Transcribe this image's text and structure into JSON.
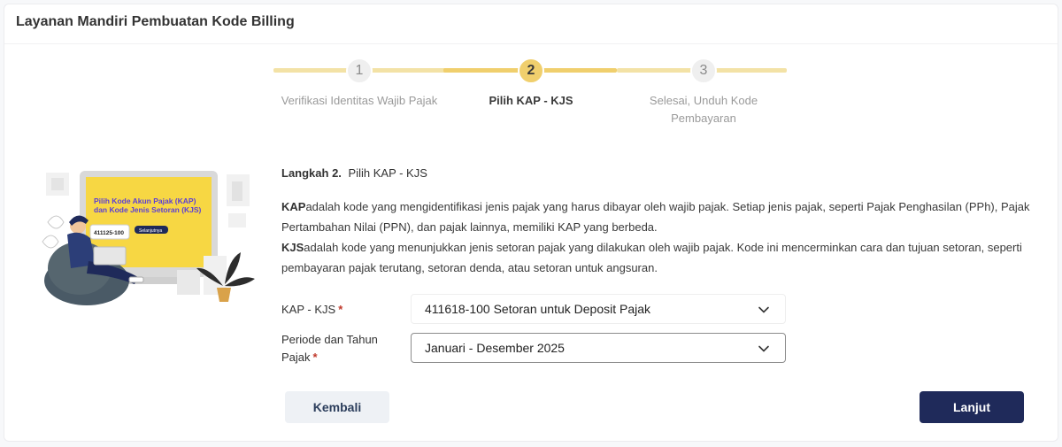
{
  "header": {
    "title": "Layanan Mandiri Pembuatan Kode Billing"
  },
  "stepper": {
    "steps": [
      {
        "number": "1",
        "label": "Verifikasi Identitas Wajib Pajak"
      },
      {
        "number": "2",
        "label": "Pilih KAP - KJS"
      },
      {
        "number": "3",
        "label": "Selesai, Unduh Kode Pembayaran"
      }
    ],
    "active_step": 2
  },
  "illustration": {
    "screen_line1": "Pilih Kode Akun Pajak (KAP)",
    "screen_line2": "dan Kode Jenis Setoran (KJS)",
    "code_bubble": "411125-100",
    "screen_button": "Selanjutnya"
  },
  "content": {
    "step_prefix": "Langkah 2.",
    "step_title": "Pilih KAP - KJS",
    "kap_term": "KAP",
    "kap_desc": "adalah kode yang mengidentifikasi jenis pajak yang harus dibayar oleh wajib pajak. Setiap jenis pajak, seperti Pajak Penghasilan (PPh), Pajak Pertambahan Nilai (PPN), dan pajak lainnya, memiliki KAP yang berbeda.",
    "kjs_term": "KJS",
    "kjs_desc": "adalah kode yang menunjukkan jenis setoran pajak yang dilakukan oleh wajib pajak. Kode ini mencerminkan cara dan tujuan setoran, seperti pembayaran pajak terutang, setoran denda, atau setoran untuk angsuran."
  },
  "form": {
    "kap_kjs": {
      "label": "KAP - KJS",
      "required_mark": "*",
      "value": "411618-100 Setoran untuk Deposit Pajak"
    },
    "periode": {
      "label": "Periode dan Tahun Pajak",
      "required_mark": "*",
      "value": "Januari - Desember 2025"
    }
  },
  "actions": {
    "back_label": "Kembali",
    "next_label": "Lanjut"
  },
  "colors": {
    "accent": "#f0cf6d",
    "primary": "#1f2a5a",
    "required": "#c0392b"
  }
}
